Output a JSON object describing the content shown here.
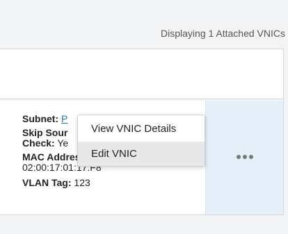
{
  "status": {
    "displaying_text": "Displaying 1 Attached VNICs"
  },
  "vnic": {
    "subnet_label": "Subnet:",
    "subnet_value": "P",
    "skip_source_label_line1": "Skip Sour",
    "skip_source_label_line2": "Check:",
    "skip_source_value": "Ye",
    "mac_label": "MAC Address:",
    "mac_value": "02:00:17:01:17:F8",
    "vlan_label": "VLAN Tag:",
    "vlan_value": "123"
  },
  "context_menu": {
    "items": [
      {
        "label": "View VNIC Details"
      },
      {
        "label": "Edit VNIC"
      }
    ],
    "highlighted_item": "Edit VNIC"
  },
  "actions": {
    "icon": "more-actions-icon"
  }
}
